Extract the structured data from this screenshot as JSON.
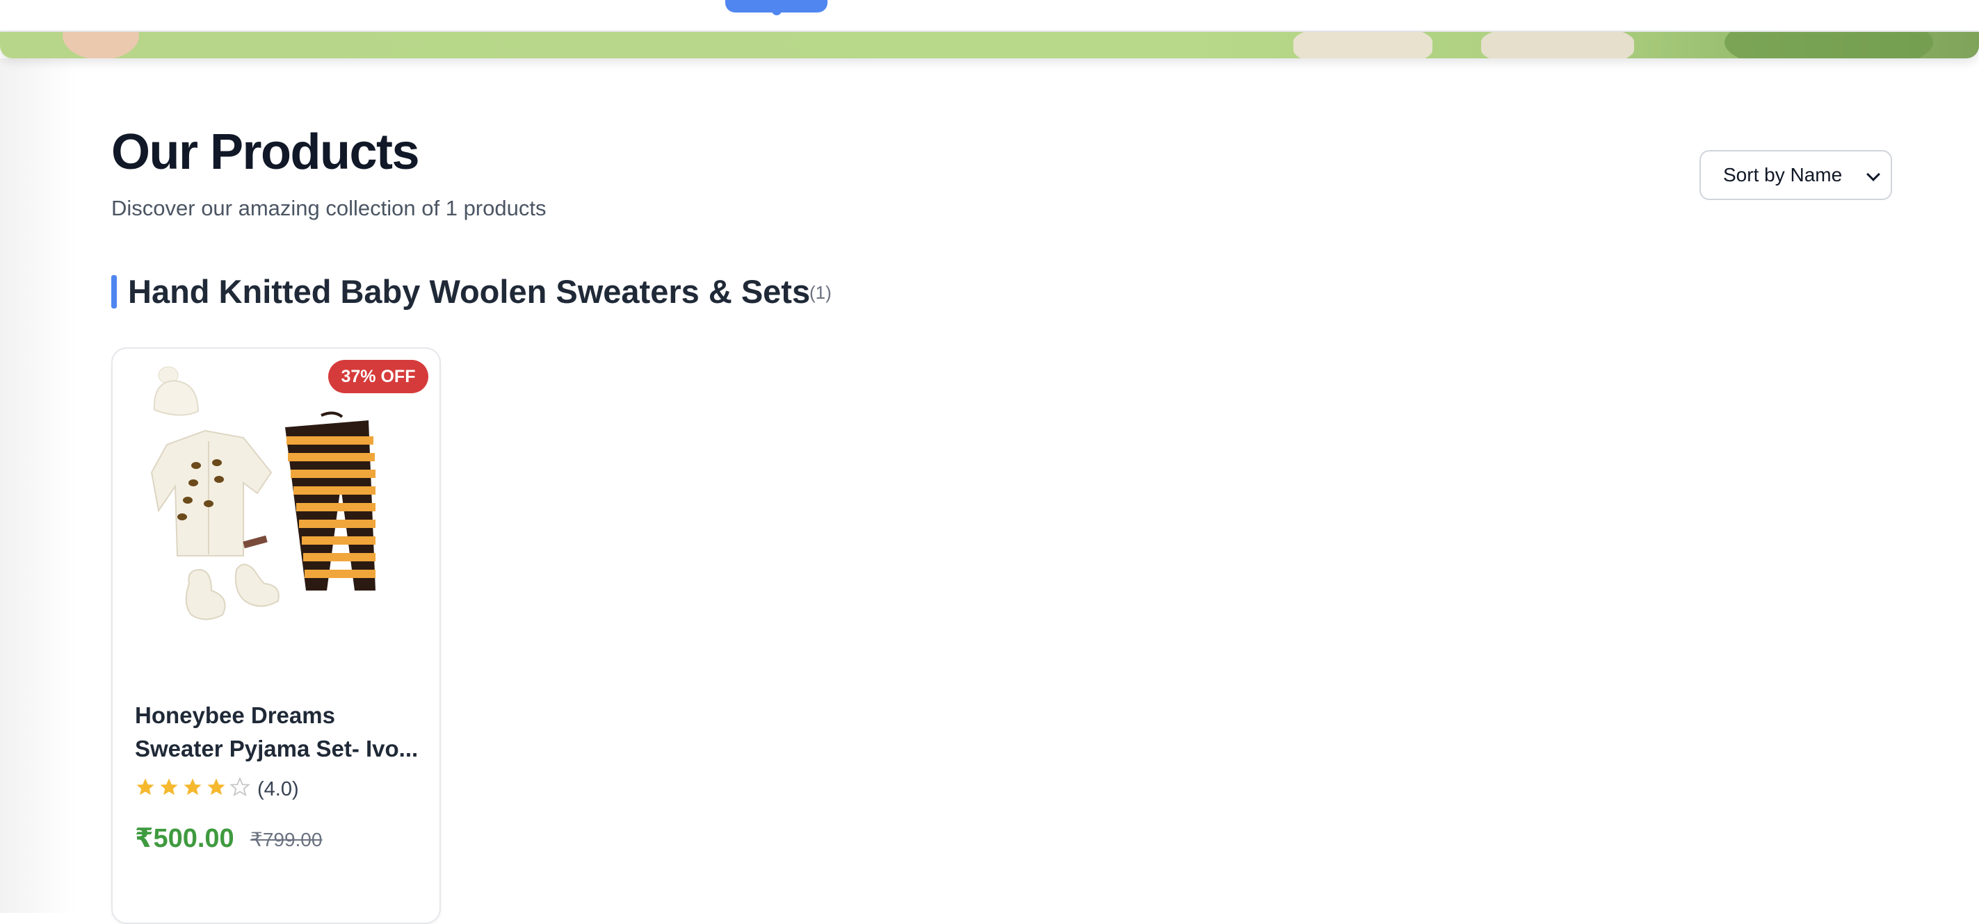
{
  "header": {},
  "catalog": {
    "title": "Our Products",
    "subtitle": "Discover our amazing collection of 1 products",
    "sort": {
      "selected": "Sort by Name"
    }
  },
  "category": {
    "name": "Hand Knitted Baby Woolen Sweaters & Sets",
    "count": "(1)"
  },
  "products": [
    {
      "name_line1": "Honeybee Dreams",
      "name_line2": "Sweater Pyjama Set- Ivo...",
      "discount": "37% OFF",
      "rating": 4.0,
      "rating_text": "(4.0)",
      "price": "₹500.00",
      "original_price": "₹799.00"
    }
  ],
  "colors": {
    "accent": "#4f86f0",
    "badge": "#d63b3b",
    "price": "#3f9a3f",
    "star": "#f5b82e"
  }
}
